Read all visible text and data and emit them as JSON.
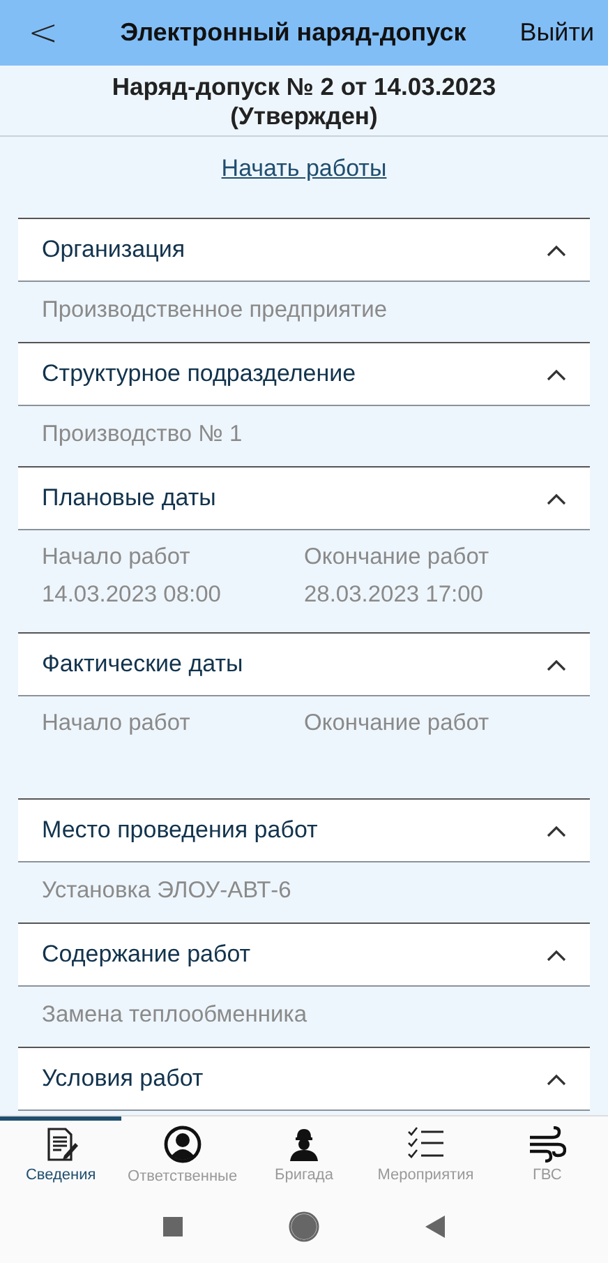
{
  "header": {
    "back": "<",
    "title": "Электронный наряд-допуск",
    "action": "Выйти"
  },
  "document": {
    "title": "Наряд-допуск № 2 от 14.03.2023",
    "status": "(Утвержден)"
  },
  "start_link": "Начать работы",
  "sections": [
    {
      "title": "Организация",
      "expanded": true,
      "kind": "text",
      "value": "Производственное предприятие"
    },
    {
      "title": "Структурное подразделение",
      "expanded": true,
      "kind": "text",
      "value": "Производство № 1"
    },
    {
      "title": "Плановые даты",
      "expanded": true,
      "kind": "dates",
      "fields": [
        {
          "label": "Начало работ",
          "value": "14.03.2023 08:00"
        },
        {
          "label": "Окончание работ",
          "value": "28.03.2023 17:00"
        }
      ]
    },
    {
      "title": "Фактические даты",
      "expanded": true,
      "kind": "dates",
      "fields": [
        {
          "label": "Начало работ"
        },
        {
          "label": "Окончание работ"
        }
      ]
    },
    {
      "title": "Место проведения работ",
      "expanded": true,
      "kind": "text",
      "value": "Установка ЭЛОУ-АВТ-6"
    },
    {
      "title": "Содержание работ",
      "expanded": true,
      "kind": "text",
      "value": "Замена теплообменника"
    },
    {
      "title": "Условия работ",
      "expanded": true,
      "kind": "text"
    }
  ],
  "tabs": [
    {
      "label": "Сведения",
      "selected": true
    },
    {
      "label": "Ответственные",
      "selected": false
    },
    {
      "label": "Бригада",
      "selected": false
    },
    {
      "label": "Мероприятия",
      "selected": false
    },
    {
      "label": "ГВС",
      "selected": false
    }
  ]
}
